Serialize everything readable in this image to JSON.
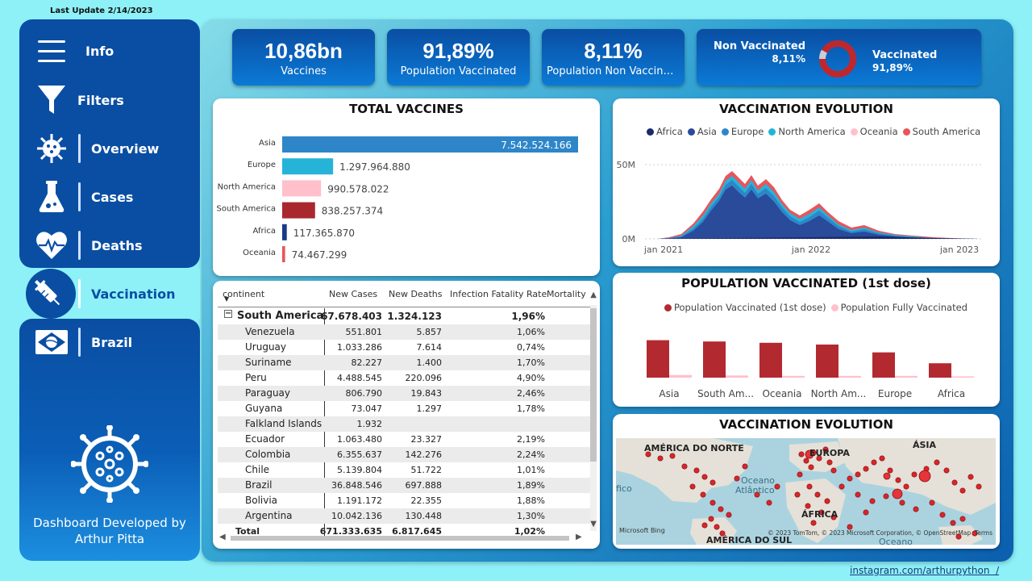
{
  "last_update": "Last Update 2/14/2023",
  "footer_link": "instagram.com/arthurpython  /",
  "credit": "Dashboard Developed by Arthur Pitta",
  "nav": [
    {
      "label": "Info",
      "icon": "menu-icon"
    },
    {
      "label": "Filters",
      "icon": "filter-icon"
    },
    {
      "label": "Overview",
      "icon": "virus-icon"
    },
    {
      "label": "Cases",
      "icon": "flask-icon"
    },
    {
      "label": "Deaths",
      "icon": "heartbeat-icon"
    },
    {
      "label": "Vaccination",
      "icon": "syringe-icon"
    },
    {
      "label": "Brazil",
      "icon": "brazil-flag-icon"
    }
  ],
  "kpis": [
    {
      "value": "10,86bn",
      "label": "Vaccines"
    },
    {
      "value": "91,89%",
      "label": "Population Vaccinated"
    },
    {
      "value": "8,11%",
      "label": "Population Non Vaccinat..."
    }
  ],
  "donut": {
    "non_label": "Non Vaccinated",
    "non_value": "8,11%",
    "vac_label": "Vaccinated",
    "vac_value": "91,89%",
    "non_fraction": 0.0811,
    "colors": {
      "vaccinated": "#c0272d",
      "non": "#c8cdd6"
    }
  },
  "total_vaccines": {
    "title": "TOTAL VACCINES",
    "chart_data": {
      "type": "bar",
      "categories": [
        "Asia",
        "Europe",
        "North America",
        "South America",
        "Africa",
        "Oceania"
      ],
      "values": [
        7542524166,
        1297964880,
        990578022,
        838257374,
        117365870,
        74467299
      ],
      "labels": [
        "7.542.524.166",
        "1.297.964.880",
        "990.578.022",
        "838.257.374",
        "117.365.870",
        "74.467.299"
      ],
      "colors": [
        "#2e86c9",
        "#25b4d8",
        "#ffc0cb",
        "#a8282e",
        "#1a3a8a",
        "#e8555c"
      ]
    }
  },
  "evolution": {
    "title": "VACCINATION EVOLUTION",
    "legend": [
      {
        "name": "Africa",
        "color": "#1a2a6c"
      },
      {
        "name": "Asia",
        "color": "#2a4a9a"
      },
      {
        "name": "Europe",
        "color": "#2e86c9"
      },
      {
        "name": "North America",
        "color": "#25b4d8"
      },
      {
        "name": "Oceania",
        "color": "#ffc0cb"
      },
      {
        "name": "South America",
        "color": "#e8555c"
      }
    ],
    "y_ticks": [
      "50M",
      "0M"
    ],
    "x_ticks": [
      "jan 2021",
      "jan 2022",
      "jan 2023"
    ]
  },
  "pop_vacc": {
    "title": "POPULATION VACCINATED (1st dose)",
    "legend": [
      {
        "name": "Population Vaccinated (1st dose)",
        "color": "#b22a30"
      },
      {
        "name": "Population Fully Vaccinated",
        "color": "#ffc0cb"
      }
    ],
    "chart_data": {
      "type": "bar",
      "categories": [
        "Asia",
        "South Am...",
        "Oceania",
        "North Am...",
        "Europe",
        "Africa"
      ],
      "series": [
        {
          "name": "Population Vaccinated (1st dose)",
          "values": [
            0.86,
            0.83,
            0.8,
            0.76,
            0.58,
            0.33
          ]
        },
        {
          "name": "Population Fully Vaccinated",
          "values": [
            0.06,
            0.05,
            0.04,
            0.04,
            0.04,
            0.03
          ]
        }
      ]
    }
  },
  "map": {
    "title": "VACCINATION EVOLUTION",
    "labels": [
      "AMÉRICA DO NORTE",
      "EUROPA",
      "ÁSIA",
      "Oceano",
      "Atlântico",
      "fico",
      "ÁFRICA",
      "AMÉRICA DO SUL",
      "Oceano"
    ],
    "bing": "Microsoft Bing",
    "attribution": "© 2023 TomTom, © 2023 Microsoft Corporation, © OpenStreetMap  Terms"
  },
  "table": {
    "headers": [
      "continent",
      "New Cases",
      "New Deaths",
      "Infection Fatality Rate",
      "Mortality"
    ],
    "group": {
      "name": "South America",
      "cases": "67.678.403",
      "deaths": "1.324.123",
      "rate": "1,96%"
    },
    "rows": [
      {
        "name": "Venezuela",
        "cases": "551.801",
        "deaths": "5.857",
        "rate": "1,06%"
      },
      {
        "name": "Uruguay",
        "cases": "1.033.286",
        "deaths": "7.614",
        "rate": "0,74%"
      },
      {
        "name": "Suriname",
        "cases": "82.227",
        "deaths": "1.400",
        "rate": "1,70%"
      },
      {
        "name": "Peru",
        "cases": "4.488.545",
        "deaths": "220.096",
        "rate": "4,90%"
      },
      {
        "name": "Paraguay",
        "cases": "806.790",
        "deaths": "19.843",
        "rate": "2,46%"
      },
      {
        "name": "Guyana",
        "cases": "73.047",
        "deaths": "1.297",
        "rate": "1,78%"
      },
      {
        "name": "Falkland Islands",
        "cases": "1.932",
        "deaths": "",
        "rate": ""
      },
      {
        "name": "Ecuador",
        "cases": "1.063.480",
        "deaths": "23.327",
        "rate": "2,19%"
      },
      {
        "name": "Colombia",
        "cases": "6.355.637",
        "deaths": "142.276",
        "rate": "2,24%"
      },
      {
        "name": "Chile",
        "cases": "5.139.804",
        "deaths": "51.722",
        "rate": "1,01%"
      },
      {
        "name": "Brazil",
        "cases": "36.848.546",
        "deaths": "697.888",
        "rate": "1,89%"
      },
      {
        "name": "Bolivia",
        "cases": "1.191.172",
        "deaths": "22.355",
        "rate": "1,88%"
      },
      {
        "name": "Argentina",
        "cases": "10.042.136",
        "deaths": "130.448",
        "rate": "1,30%"
      }
    ],
    "total": {
      "name": "Total",
      "cases": "671.333.635",
      "deaths": "6.817.645",
      "rate": "1,02%"
    }
  }
}
